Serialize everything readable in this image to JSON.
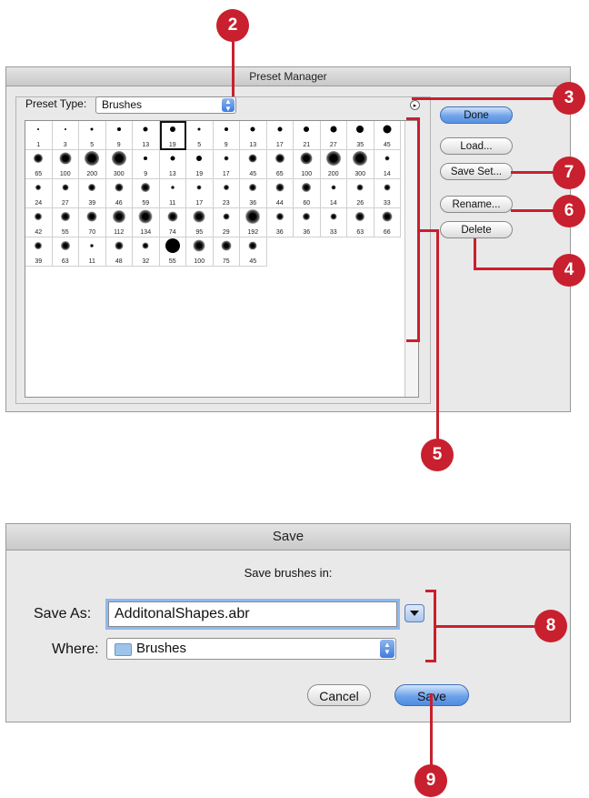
{
  "preset_manager": {
    "title": "Preset Manager",
    "preset_type_label": "Preset Type:",
    "preset_type_value": "Brushes",
    "buttons": {
      "done": "Done",
      "load": "Load...",
      "save_set": "Save Set...",
      "rename": "Rename...",
      "delete": "Delete"
    },
    "brush_sizes": [
      "1",
      "3",
      "5",
      "9",
      "13",
      "19",
      "5",
      "9",
      "13",
      "17",
      "21",
      "27",
      "35",
      "45",
      "65",
      "100",
      "200",
      "300",
      "9",
      "13",
      "19",
      "17",
      "45",
      "65",
      "100",
      "200",
      "300",
      "14",
      "24",
      "27",
      "39",
      "46",
      "59",
      "11",
      "17",
      "23",
      "36",
      "44",
      "60",
      "14",
      "26",
      "33",
      "42",
      "55",
      "70",
      "112",
      "134",
      "74",
      "95",
      "29",
      "192",
      "36",
      "36",
      "33",
      "63",
      "66",
      "39",
      "63",
      "11",
      "48",
      "32",
      "55",
      "100",
      "75",
      "45"
    ]
  },
  "save_dialog": {
    "title": "Save",
    "heading": "Save brushes in:",
    "save_as_label": "Save As:",
    "save_as_value": "AdditonalShapes.abr",
    "where_label": "Where:",
    "where_value": "Brushes",
    "cancel": "Cancel",
    "save": "Save"
  },
  "callouts": {
    "c2": "2",
    "c3": "3",
    "c7": "7",
    "c6": "6",
    "c4": "4",
    "c5": "5",
    "c8": "8",
    "c9": "9"
  },
  "colors": {
    "callout": "#c8202e",
    "accent": "#5a93e2"
  }
}
